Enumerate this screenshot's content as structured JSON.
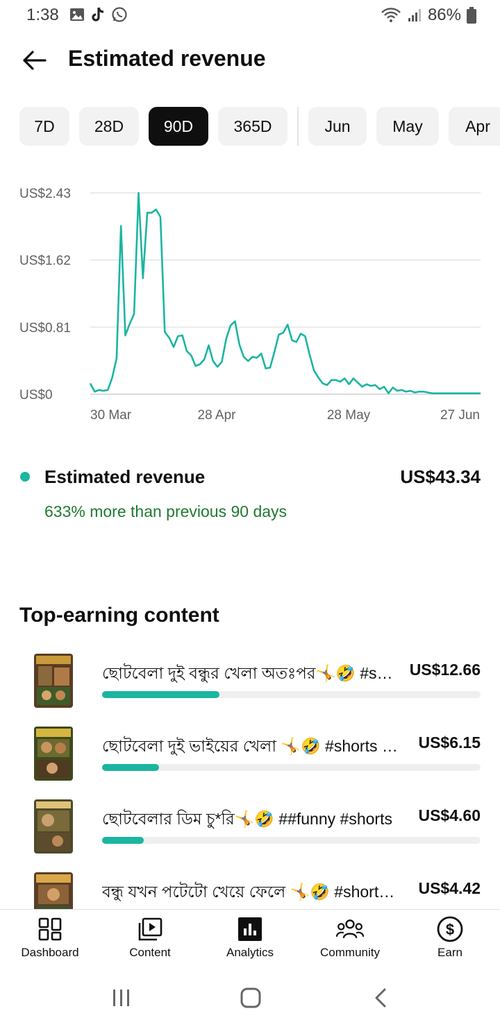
{
  "status_bar": {
    "time": "1:38",
    "battery": "86%"
  },
  "header": {
    "title": "Estimated revenue"
  },
  "chips": {
    "items": [
      {
        "label": "7D",
        "selected": false
      },
      {
        "label": "28D",
        "selected": false
      },
      {
        "label": "90D",
        "selected": true
      },
      {
        "label": "365D",
        "selected": false
      },
      {
        "label": "Jun",
        "selected": false
      },
      {
        "label": "May",
        "selected": false
      },
      {
        "label": "Apr",
        "selected": false
      }
    ]
  },
  "chart_data": {
    "type": "line",
    "y_tick_labels": [
      "US$2.43",
      "US$1.62",
      "US$0.81",
      "US$0"
    ],
    "y_ticks": [
      2.43,
      1.62,
      0.81,
      0
    ],
    "x_tick_labels": [
      "30 Mar",
      "28 Apr",
      "28 May",
      "27 Jun"
    ],
    "ylim": [
      0,
      2.43
    ],
    "grid": true,
    "color": "#1bb5a0",
    "values": [
      0.13,
      0.03,
      0.05,
      0.04,
      0.05,
      0.2,
      0.43,
      2.03,
      0.71,
      0.85,
      0.97,
      2.43,
      1.4,
      2.19,
      2.19,
      2.23,
      2.14,
      0.75,
      0.68,
      0.57,
      0.7,
      0.71,
      0.52,
      0.47,
      0.34,
      0.36,
      0.42,
      0.59,
      0.4,
      0.33,
      0.39,
      0.67,
      0.83,
      0.88,
      0.6,
      0.45,
      0.4,
      0.45,
      0.44,
      0.49,
      0.31,
      0.32,
      0.51,
      0.72,
      0.74,
      0.84,
      0.65,
      0.63,
      0.73,
      0.7,
      0.48,
      0.29,
      0.2,
      0.13,
      0.11,
      0.17,
      0.17,
      0.15,
      0.19,
      0.12,
      0.19,
      0.14,
      0.09,
      0.12,
      0.1,
      0.11,
      0.06,
      0.09,
      0.01,
      0.08,
      0.04,
      0.05,
      0.03,
      0.04,
      0.02,
      0.03,
      0.03,
      0.02,
      0.01,
      0.01,
      0.01,
      0.01,
      0.01,
      0.01,
      0.01,
      0.01,
      0.01,
      0.01,
      0.01,
      0.01
    ]
  },
  "summary": {
    "label": "Estimated revenue",
    "value": "US$43.34",
    "change": "633% more than previous 90 days",
    "dot_color": "#1bb5a0"
  },
  "top_earning": {
    "title": "Top-earning content",
    "items": [
      {
        "title": "ছোটবেলা দুই বন্ধুর খেলা অতঃপর🤸🤣 #shorts #funny",
        "value": "US$12.66",
        "share": 0.31
      },
      {
        "title": "ছোটবেলা দুই ভাইয়ের খেলা 🤸🤣 #shorts #funny",
        "value": "US$6.15",
        "share": 0.15
      },
      {
        "title": "ছোটবেলার ডিম চু*রি🤸🤣 ##funny #shorts",
        "value": "US$4.60",
        "share": 0.11
      },
      {
        "title": "বন্ধু যখন পটেটো খেয়ে ফেলে 🤸🤣 #shorts #funny",
        "value": "US$4.42",
        "share": 0.11
      }
    ]
  },
  "bottom_nav": {
    "items": [
      {
        "label": "Dashboard",
        "icon": "dashboard-icon"
      },
      {
        "label": "Content",
        "icon": "content-icon"
      },
      {
        "label": "Analytics",
        "icon": "analytics-icon",
        "active": true
      },
      {
        "label": "Community",
        "icon": "community-icon"
      },
      {
        "label": "Earn",
        "icon": "earn-icon"
      }
    ]
  },
  "system_nav": {
    "items": [
      "recent-apps-icon",
      "home-icon",
      "back-icon"
    ]
  }
}
